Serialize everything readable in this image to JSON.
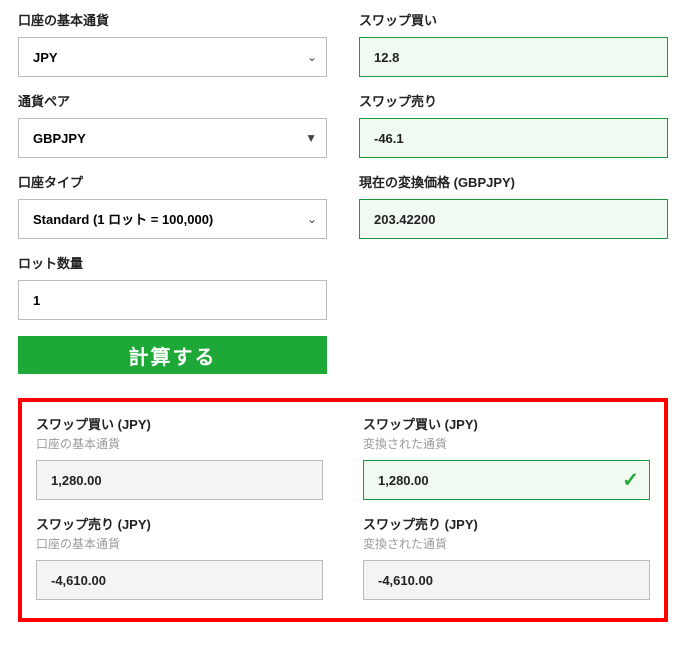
{
  "labels": {
    "base_currency": "口座の基本通貨",
    "swap_buy": "スワップ買い",
    "pair": "通貨ペア",
    "swap_sell": "スワップ売り",
    "account_type": "口座タイプ",
    "conversion_price": "現在の変換価格 (GBPJPY)",
    "lot_qty": "ロット数量",
    "calc_button": "計算する"
  },
  "values": {
    "base_currency": "JPY",
    "swap_buy": "12.8",
    "pair": "GBPJPY",
    "swap_sell": "-46.1",
    "account_type": "Standard (1 ロット = 100,000)",
    "conversion_price": "203.42200",
    "lot_qty": "1"
  },
  "results": {
    "buy_base_title": "スワップ買い (JPY)",
    "buy_base_sub": "口座の基本通貨",
    "buy_base_value": "1,280.00",
    "buy_conv_title": "スワップ買い (JPY)",
    "buy_conv_sub": "変換された通貨",
    "buy_conv_value": "1,280.00",
    "sell_base_title": "スワップ売り (JPY)",
    "sell_base_sub": "口座の基本通貨",
    "sell_base_value": "-4,610.00",
    "sell_conv_title": "スワップ売り (JPY)",
    "sell_conv_sub": "変換された通貨",
    "sell_conv_value": "-4,610.00"
  }
}
